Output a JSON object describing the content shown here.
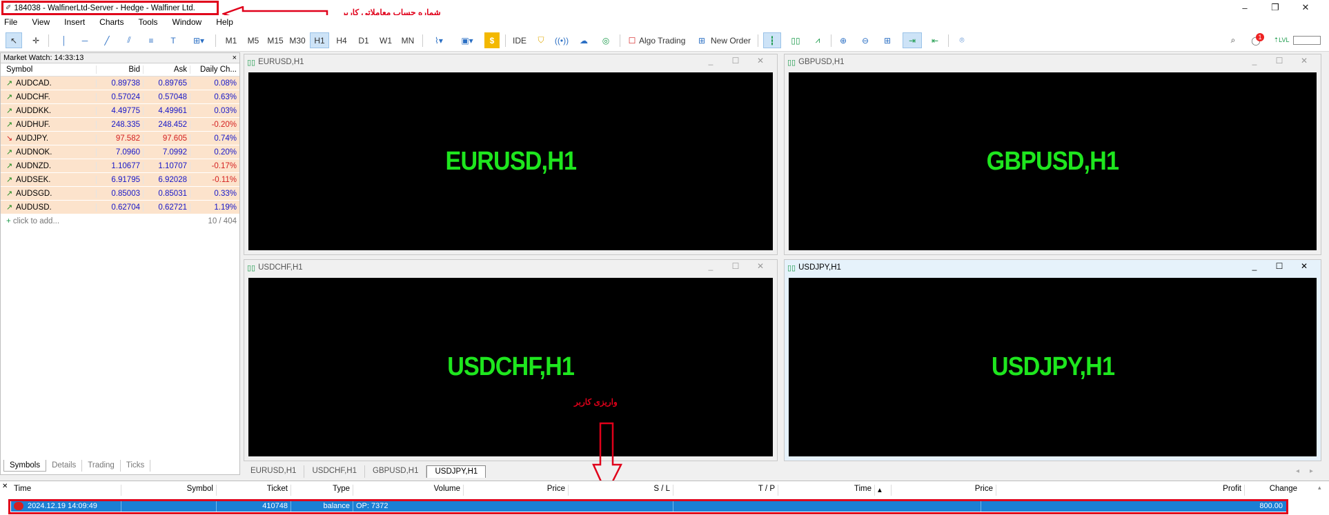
{
  "window": {
    "title": "184038 - WalfinerLtd-Server - Hedge - Walfiner Ltd.",
    "minimize": "–",
    "restore": "❐",
    "close": "✕"
  },
  "annotations": {
    "top_note": "شماره حساب معاملاتی کاربر",
    "bottom_note": "واریزی کاربر"
  },
  "menu": [
    "File",
    "View",
    "Insert",
    "Charts",
    "Tools",
    "Window",
    "Help"
  ],
  "toolbar": {
    "timeframes": [
      "M1",
      "M5",
      "M15",
      "M30",
      "H1",
      "H4",
      "D1",
      "W1",
      "MN"
    ],
    "active_timeframe": "H1",
    "ide": "IDE",
    "algo": "Algo Trading",
    "new_order": "New Order",
    "notif_count": "1"
  },
  "market_watch": {
    "title": "Market Watch: 14:33:13",
    "columns": [
      "Symbol",
      "Bid",
      "Ask",
      "Daily Ch..."
    ],
    "rows": [
      {
        "symbol": "AUDCAD.",
        "bid": "0.89738",
        "ask": "0.89765",
        "change": "0.08%",
        "dir": "up"
      },
      {
        "symbol": "AUDCHF.",
        "bid": "0.57024",
        "ask": "0.57048",
        "change": "0.63%",
        "dir": "up"
      },
      {
        "symbol": "AUDDKK.",
        "bid": "4.49775",
        "ask": "4.49961",
        "change": "0.03%",
        "dir": "up"
      },
      {
        "symbol": "AUDHUF.",
        "bid": "248.335",
        "ask": "248.452",
        "change": "-0.20%",
        "dir": "up"
      },
      {
        "symbol": "AUDJPY.",
        "bid": "97.582",
        "ask": "97.605",
        "change": "0.74%",
        "dir": "down"
      },
      {
        "symbol": "AUDNOK.",
        "bid": "7.0960",
        "ask": "7.0992",
        "change": "0.20%",
        "dir": "up"
      },
      {
        "symbol": "AUDNZD.",
        "bid": "1.10677",
        "ask": "1.10707",
        "change": "-0.17%",
        "dir": "up"
      },
      {
        "symbol": "AUDSEK.",
        "bid": "6.91795",
        "ask": "6.92028",
        "change": "-0.11%",
        "dir": "up"
      },
      {
        "symbol": "AUDSGD.",
        "bid": "0.85003",
        "ask": "0.85031",
        "change": "0.33%",
        "dir": "up"
      },
      {
        "symbol": "AUDUSD.",
        "bid": "0.62704",
        "ask": "0.62721",
        "change": "1.19%",
        "dir": "up"
      }
    ],
    "add_label": "click to add...",
    "count": "10 / 404",
    "tabs": [
      "Symbols",
      "Details",
      "Trading",
      "Ticks"
    ]
  },
  "charts": [
    {
      "title": "EURUSD,H1",
      "label": "EURUSD,H1"
    },
    {
      "title": "GBPUSD,H1",
      "label": "GBPUSD,H1"
    },
    {
      "title": "USDCHF,H1",
      "label": "USDCHF,H1"
    },
    {
      "title": "USDJPY,H1",
      "label": "USDJPY,H1"
    }
  ],
  "chart_tabs": [
    "EURUSD,H1",
    "USDCHF,H1",
    "GBPUSD,H1",
    "USDJPY,H1"
  ],
  "toolbox": {
    "columns": [
      "Time",
      "Symbol",
      "Ticket",
      "Type",
      "Volume",
      "Price",
      "S / L",
      "T / P",
      "Time",
      "Price",
      "Profit",
      "Change"
    ],
    "row": {
      "time": "2024.12.19 14:09:49",
      "ticket": "410748",
      "type": "balance",
      "comment": "OP: 7372",
      "profit": "800.00"
    }
  }
}
